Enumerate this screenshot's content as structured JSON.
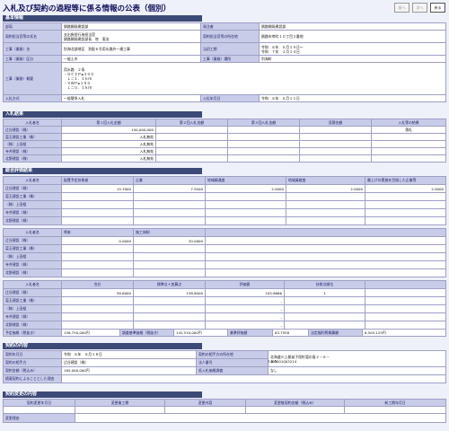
{
  "title": "入札及び契約の過程等に係る情報の公表（個別）",
  "toolbar": {
    "prev": "前へ",
    "next": "次へ",
    "back": "戻る"
  },
  "basic": {
    "section": "基本情報",
    "dept_label": "部局",
    "dept": "釧路開発建設部",
    "contractor_label": "発注者",
    "contractor": "釧路開発建設部",
    "officer_label": "契約担当官等の氏名",
    "officer1": "支出負担行為担当官",
    "officer2": "釧路開発建設部長　笹　憲治",
    "addr_label": "契約担当官等の所在地",
    "addr": "釧路市幸町１０丁目３番地",
    "work_label": "工事（業務）名",
    "work": "別海北部地区　別配６号用水路外一連工事",
    "period_label": "当初工期",
    "period1": "令和　６年　６月１９日〜",
    "period2": "令和　７年　２月１４日",
    "cat_label": "工事（業務）区分",
    "cat": "一般土木",
    "place_label": "工事（業務）場所",
    "place": "別海町",
    "outline_label": "工事（業務）概要",
    "outline": [
      "用水路　２条",
      "・ＤＣＩＰφ３００",
      "　Ｌ＝１．１ｋｍ",
      "・ＶＷＰφ１５０",
      "　Ｌ＝０．１ｋｍ"
    ],
    "method_label": "入札方式",
    "method": "一般競争入札",
    "date_label": "入札年月日",
    "date": "令和　６年　６月１１日"
  },
  "bids": {
    "section": "入札結果",
    "headers": [
      "入札者名",
      "第１回入札金額",
      "第２回入札金額",
      "第３回入札金額",
      "見積金額",
      "入札等の結果"
    ],
    "rows": [
      [
        "辻谷建設（株）",
        "150,000,000",
        "",
        "",
        "",
        "落札"
      ],
      [
        "葛玉建設工業（株）",
        "入札無効",
        "",
        "",
        "",
        ""
      ],
      [
        "（株）上田組",
        "入札無効",
        "",
        "",
        "",
        ""
      ],
      [
        "寺井建設（株）",
        "入札無効",
        "",
        "",
        "",
        ""
      ],
      [
        "北野建設（株）",
        "入札無効",
        "",
        "",
        "",
        ""
      ]
    ]
  },
  "eval": {
    "section": "総合評価結果",
    "t1_headers": [
      "入札者名",
      "配置予定技術者",
      "企業",
      "地域精通度",
      "地域貢献度",
      "最上げの実施を目指した企業等"
    ],
    "t1_rows": [
      [
        "辻谷建設（株）",
        "15.3000",
        "7.5000",
        "2.0000",
        "2.0000",
        "2.0000"
      ],
      [
        "葛玉建設工業（株）",
        "",
        "",
        "",
        "",
        ""
      ],
      [
        "（株）上田組",
        "",
        "",
        "",
        "",
        ""
      ],
      [
        "寺井建設（株）",
        "",
        "",
        "",
        "",
        ""
      ],
      [
        "北野建設（株）",
        "",
        "",
        "",
        "",
        ""
      ]
    ],
    "t2_headers": [
      "入札者名",
      "将来",
      "施工体制"
    ],
    "t2_rows": [
      [
        "辻谷建設（株）",
        "0.0000",
        "30.0000"
      ],
      [
        "葛玉建設工業（株）",
        "",
        ""
      ],
      [
        "（株）上田組",
        "",
        ""
      ],
      [
        "寺井建設（株）",
        "",
        ""
      ],
      [
        "北野建設（株）",
        "",
        ""
      ]
    ],
    "t3_headers": [
      "入札者名",
      "合計",
      "標準点＋加算点",
      "評価値",
      "技術点順位"
    ],
    "t3_rows": [
      [
        "辻谷建設（株）",
        "58.8000",
        "158.8000",
        "105.8666",
        "1"
      ],
      [
        "葛玉建設工業（株）",
        "",
        "",
        "-",
        ""
      ],
      [
        "（株）上田組",
        "",
        "",
        "-",
        ""
      ],
      [
        "寺井建設（株）",
        "",
        "",
        "-",
        ""
      ],
      [
        "北野建設（株）",
        "",
        "",
        "-",
        ""
      ]
    ]
  },
  "price": {
    "est_label": "予定価格（税抜き）",
    "est": "156,750,000円",
    "base_label": "調査基準価格（税抜き）",
    "base": "142,510,000円",
    "score_label": "基準評価値",
    "score": "63.7958",
    "welfare_label": "法定福利費概算額",
    "welfare": "6,505,125円"
  },
  "contract": {
    "section": "契約の内容",
    "date_label": "契約年月日",
    "date": "令和　６年　６月１８日",
    "addr_label": "契約の相手方の所在地",
    "addr1": "北海道川上郡弟子屈町湯の島２－６－",
    "addr2": "１５",
    "name_label": "契約の相手方",
    "name": "辻谷建設（株）",
    "corp_label": "法人番号",
    "corp": "7460001003214",
    "amount_label": "契約金額（税込み）",
    "amount": "165,000,000円",
    "survey_label": "低入札価格調査",
    "survey": "なし",
    "reason_label": "随意契約によることとした理由",
    "reason": ""
  },
  "change": {
    "section": "契約変更の内容",
    "headers": [
      "契約変更年月日",
      "変更後工期",
      "変更内容",
      "変更後契約金額（税込み）",
      "新工期年月日"
    ],
    "reason_label": "変更理由",
    "reason": ""
  }
}
